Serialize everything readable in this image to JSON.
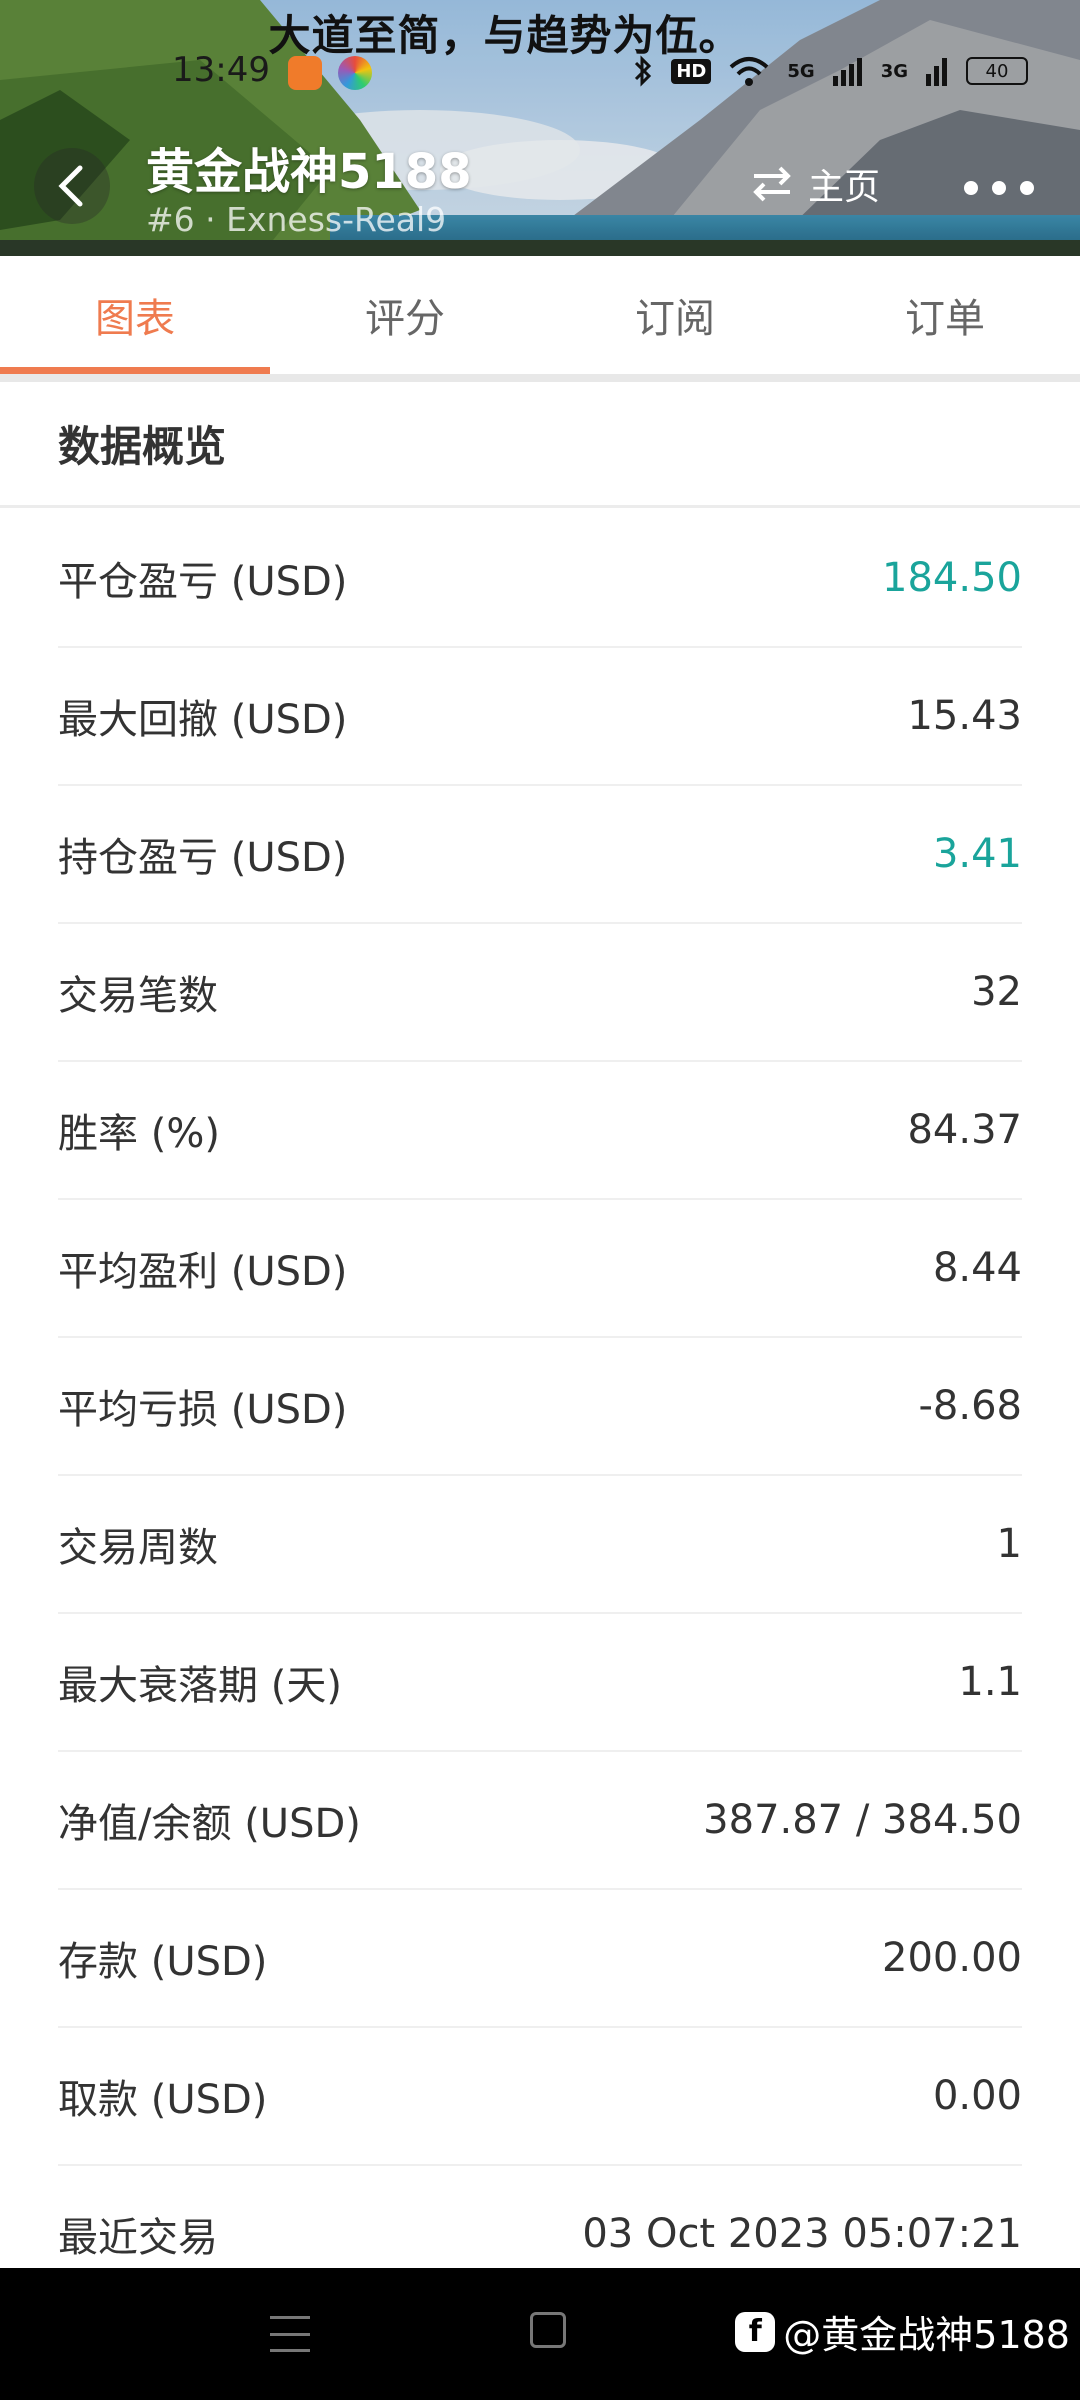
{
  "status_bar": {
    "banner": "大道至简，与趋势为伍。",
    "time": "13:49",
    "network": "HD",
    "signal_5g": "5G",
    "signal_3g": "3G",
    "battery": "40"
  },
  "header": {
    "title": "黄金战神5188",
    "subtitle": "#6 · Exness-Real9",
    "home_label": "主页"
  },
  "tabs": [
    {
      "label": "图表",
      "active": true
    },
    {
      "label": "评分",
      "active": false
    },
    {
      "label": "订阅",
      "active": false
    },
    {
      "label": "订单",
      "active": false
    }
  ],
  "section": {
    "title": "数据概览"
  },
  "stats": [
    {
      "label": "平仓盈亏 (USD)",
      "value": "184.50",
      "color": "#1aa49b"
    },
    {
      "label": "最大回撤 (USD)",
      "value": "15.43"
    },
    {
      "label": "持仓盈亏 (USD)",
      "value": "3.41",
      "color": "#1aa49b"
    },
    {
      "label": "交易笔数",
      "value": "32"
    },
    {
      "label": "胜率 (%)",
      "value": "84.37"
    },
    {
      "label": "平均盈利 (USD)",
      "value": "8.44"
    },
    {
      "label": "平均亏损 (USD)",
      "value": "-8.68"
    },
    {
      "label": "交易周数",
      "value": "1"
    },
    {
      "label": "最大衰落期 (天)",
      "value": "1.1"
    },
    {
      "label": "净值/余额 (USD)",
      "value": "387.87 / 384.50"
    },
    {
      "label": "存款 (USD)",
      "value": "200.00"
    },
    {
      "label": "取款 (USD)",
      "value": "0.00"
    },
    {
      "label": "最近交易",
      "value": "03 Oct 2023 05:07:21"
    }
  ],
  "watermark": {
    "text": "@黄金战神5188"
  },
  "colors": {
    "accent": "#ef7b4f",
    "profit": "#1aa49b"
  }
}
